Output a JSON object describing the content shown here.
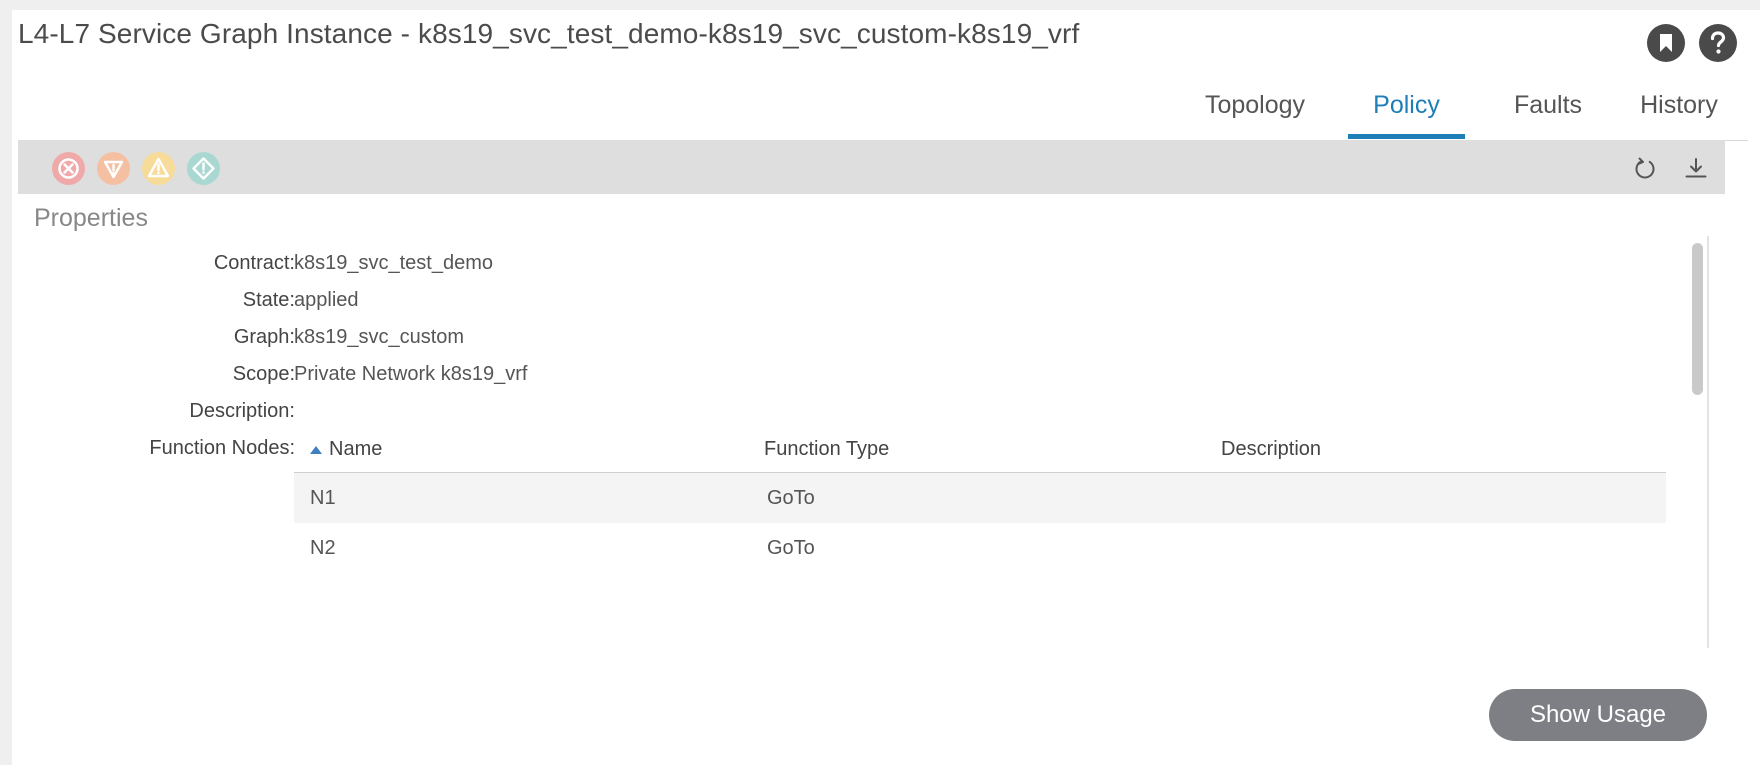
{
  "header": {
    "title": "L4-L7 Service Graph Instance - k8s19_svc_test_demo-k8s19_svc_custom-k8s19_vrf"
  },
  "tabs": [
    {
      "label": "Topology"
    },
    {
      "label": "Policy",
      "active": true
    },
    {
      "label": "Faults"
    },
    {
      "label": "History"
    }
  ],
  "toolbar": {
    "fault_icons": [
      "critical-fault-icon",
      "major-fault-icon",
      "minor-fault-icon",
      "warning-fault-icon"
    ],
    "fault_colors": [
      "#f0a9a9",
      "#f5c0a2",
      "#f6dc98",
      "#a9d8d2"
    ],
    "actions": [
      "refresh-icon",
      "download-icon"
    ]
  },
  "properties": {
    "section_title": "Properties",
    "contract_label": "Contract:",
    "contract_value": "k8s19_svc_test_demo",
    "state_label": "State:",
    "state_value": "applied",
    "graph_label": "Graph:",
    "graph_value": "k8s19_svc_custom",
    "scope_label": "Scope:",
    "scope_value": "Private Network k8s19_vrf",
    "description_label": "Description:",
    "description_value": "",
    "function_nodes_label": "Function Nodes:"
  },
  "function_nodes": {
    "columns": [
      "Name",
      "Function Type",
      "Description"
    ],
    "sorted_column": "Name",
    "rows": [
      {
        "name": "N1",
        "type": "GoTo",
        "description": ""
      },
      {
        "name": "N2",
        "type": "GoTo",
        "description": ""
      }
    ]
  },
  "footer": {
    "show_usage_label": "Show Usage"
  },
  "colors": {
    "accent": "#1e7fb8",
    "button": "#7d7f84"
  }
}
